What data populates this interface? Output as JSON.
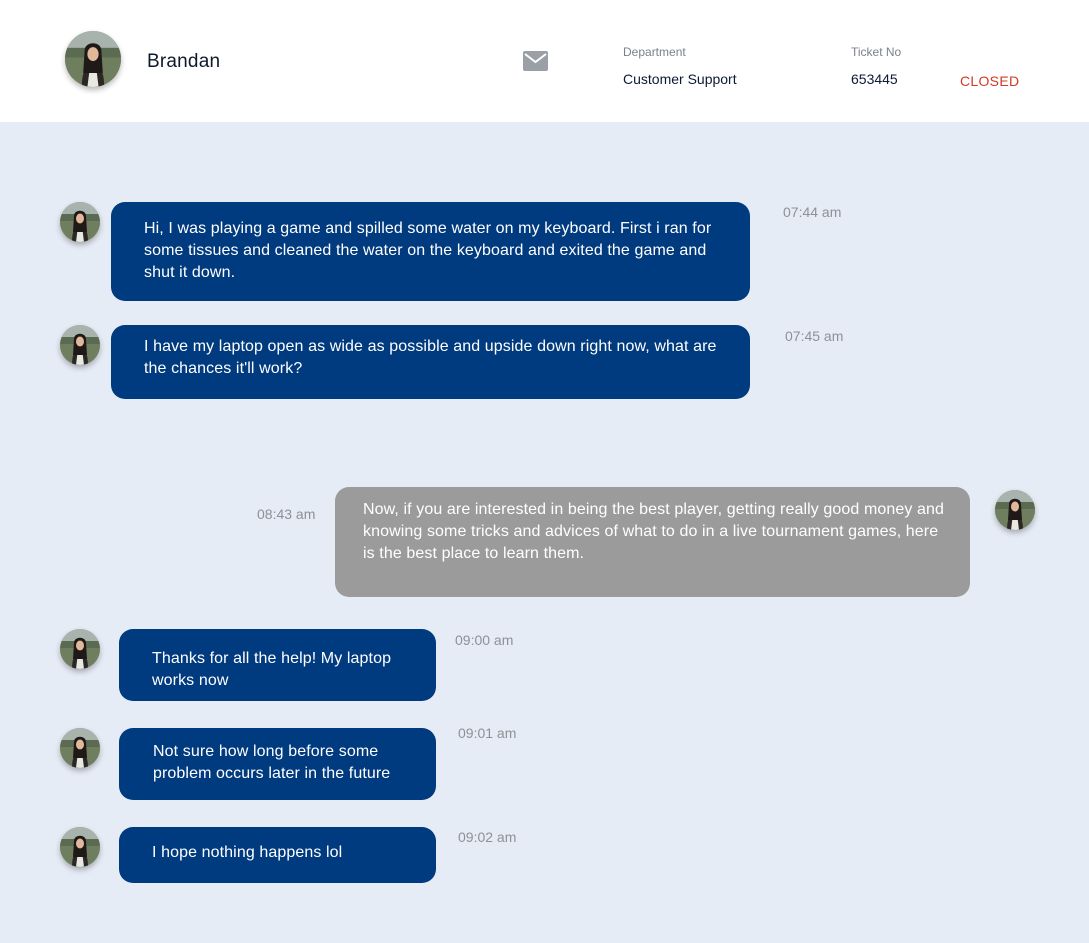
{
  "header": {
    "user_name": "Brandan",
    "department_label": "Department",
    "department_value": "Customer Support",
    "ticket_label": "Ticket No",
    "ticket_value": "653445",
    "status": "CLOSED",
    "mail_icon": "mail-icon"
  },
  "colors": {
    "incoming_bubble": "#003A7F",
    "outgoing_bubble": "#9B9B9B",
    "status_closed": "#D33A22",
    "chat_background": "#E6ECF6"
  },
  "messages": [
    {
      "direction": "incoming",
      "text": "Hi,  I was playing a game and spilled some water on my keyboard. First i ran for some tissues and cleaned the water on the keyboard and exited the game and shut it down.",
      "time": "07:44 am"
    },
    {
      "direction": "incoming",
      "text": "I have my laptop open as wide as possible and upside down right now, what are the chances it'll work?",
      "time": "07:45 am"
    },
    {
      "direction": "outgoing",
      "text": "Now, if you are interested in being the best player, getting really good money and knowing some tricks and advices of what to do in a live tournament games, here is the best place to learn them.",
      "time": "08:43 am"
    },
    {
      "direction": "incoming",
      "text": "Thanks for all the help! My laptop works now",
      "time": "09:00 am"
    },
    {
      "direction": "incoming",
      "text": "Not sure how long before some problem occurs later in the future",
      "time": "09:01 am"
    },
    {
      "direction": "incoming",
      "text": "I hope nothing happens lol",
      "time": "09:02 am"
    }
  ]
}
